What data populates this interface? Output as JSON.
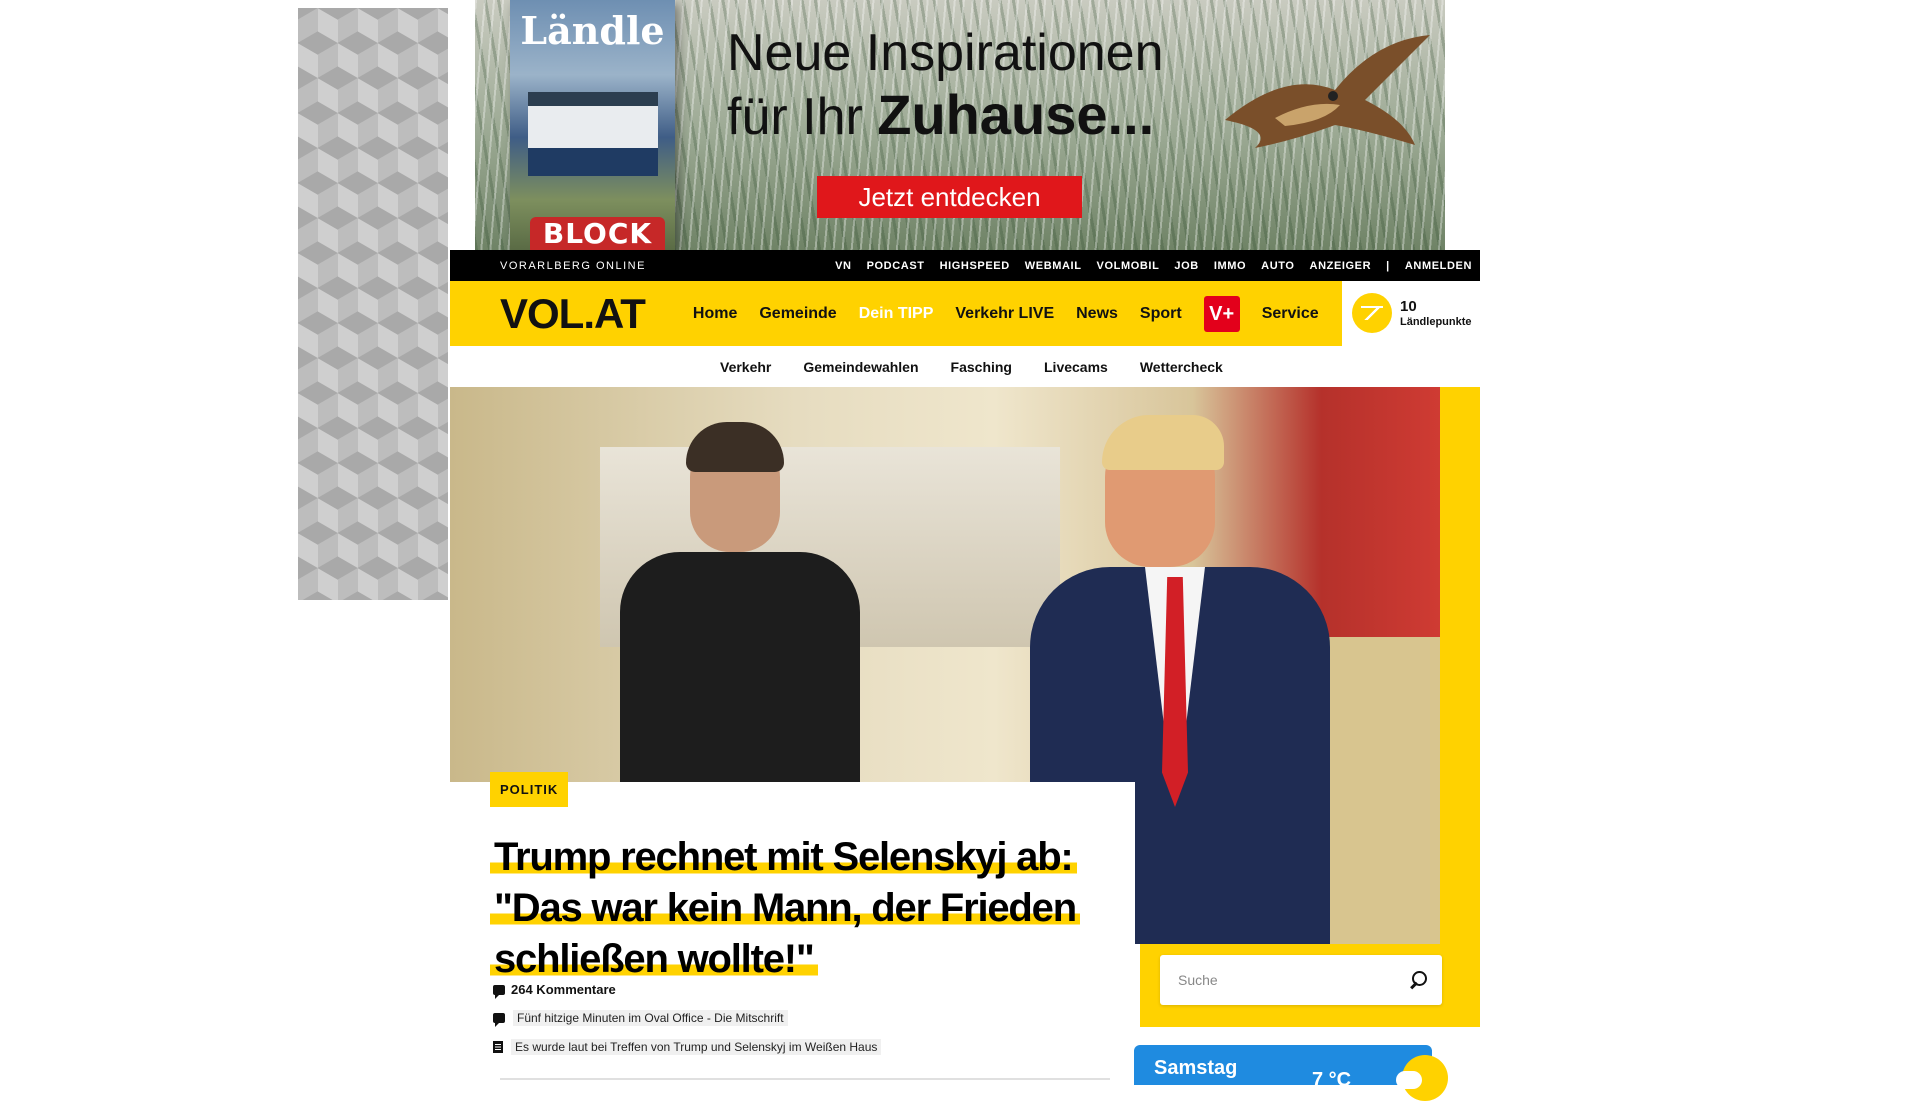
{
  "banner_ad": {
    "magazine_title": "Ländle",
    "magazine_brand": "BLOCK",
    "headline_line1": "Neue Inspirationen",
    "headline_line2_prefix": "für Ihr ",
    "headline_line2_bold": "Zuhause...",
    "cta": "Jetzt entdecken"
  },
  "topbar": {
    "brand": "VORARLBERG ONLINE",
    "links": [
      "VN",
      "PODCAST",
      "HIGHSPEED",
      "WEBMAIL",
      "VOLMOBIL",
      "JOB",
      "IMMO",
      "AUTO",
      "ANZEIGER",
      "|",
      "ANMELDEN"
    ]
  },
  "mainnav": {
    "logo": "VOL.AT",
    "items": [
      "Home",
      "Gemeinde",
      "Dein TIPP",
      "Verkehr LIVE",
      "News",
      "Sport"
    ],
    "vplus": "V+",
    "service": "Service",
    "points_value": "10",
    "points_label": "Ländlepunkte"
  },
  "subnav": {
    "items": [
      "Verkehr",
      "Gemeindewahlen",
      "Fasching",
      "Livecams",
      "Wettercheck"
    ]
  },
  "article": {
    "category": "POLITIK",
    "headline_lines": [
      "Trump rechnet mit Selenskyj ab:",
      "\"Das war kein Mann, der Frieden",
      "schließen wollte!\""
    ],
    "comments": "264 Kommentare",
    "related": [
      {
        "icon": "comment-icon",
        "text": "Fünf hitzige Minuten im Oval Office - Die Mitschrift"
      },
      {
        "icon": "document-icon",
        "text": "Es wurde laut bei Treffen von Trump und Selenskyj im Weißen Haus"
      }
    ]
  },
  "search": {
    "placeholder": "Suche"
  },
  "weather": {
    "day": "Samstag",
    "temp": "7 °C"
  },
  "colors": {
    "accent_yellow": "#ffd200",
    "vplus_red": "#e3001b",
    "weather_blue": "#1f8be0"
  }
}
